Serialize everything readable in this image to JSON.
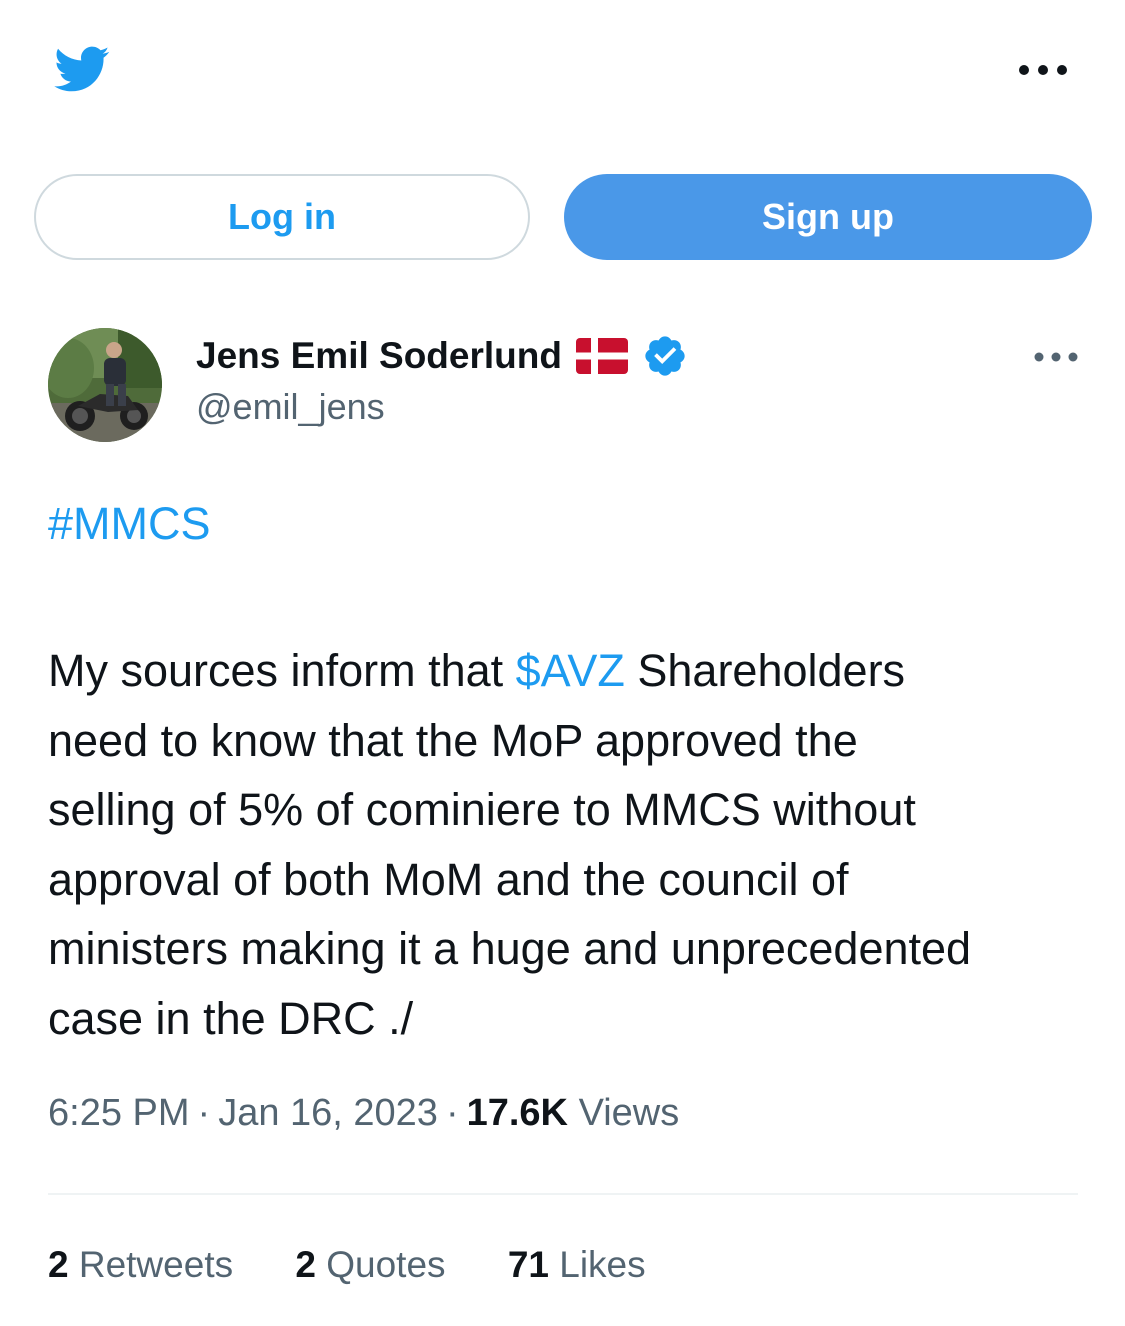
{
  "header": {
    "logo_icon": "twitter-bird-icon",
    "more_icon": "more-horizontal-icon"
  },
  "auth": {
    "login_label": "Log in",
    "signup_label": "Sign up"
  },
  "author": {
    "display_name": "Jens Emil Soderlund",
    "handle": "@emil_jens",
    "flag_icon": "denmark-flag-icon",
    "verified_icon": "verified-badge-icon",
    "more_icon": "more-horizontal-icon"
  },
  "tweet": {
    "hashtag": "#MMCS",
    "text_prefix": "My sources inform that ",
    "cashtag": "$AVZ",
    "line1_suffix": " Shareholders",
    "line2": "need to know that the MoP approved the",
    "line3": "selling of 5% of cominiere to MMCS without",
    "line4": "approval of both MoM and the council of",
    "line5": "ministers making it a huge and unprecedented",
    "line6": "case in the DRC ./",
    "time": "6:25 PM",
    "date": "Jan 16, 2023",
    "separator": "·",
    "views_count": "17.6K",
    "views_label": "Views"
  },
  "stats": {
    "retweets_count": "2",
    "retweets_label": "Retweets",
    "quotes_count": "2",
    "quotes_label": "Quotes",
    "likes_count": "71",
    "likes_label": "Likes"
  },
  "colors": {
    "brand_blue": "#1d9bf0",
    "signup_bg": "#4a98e8",
    "text_primary": "#0f1419",
    "text_secondary": "#536471",
    "flag_red": "#c8102e"
  }
}
